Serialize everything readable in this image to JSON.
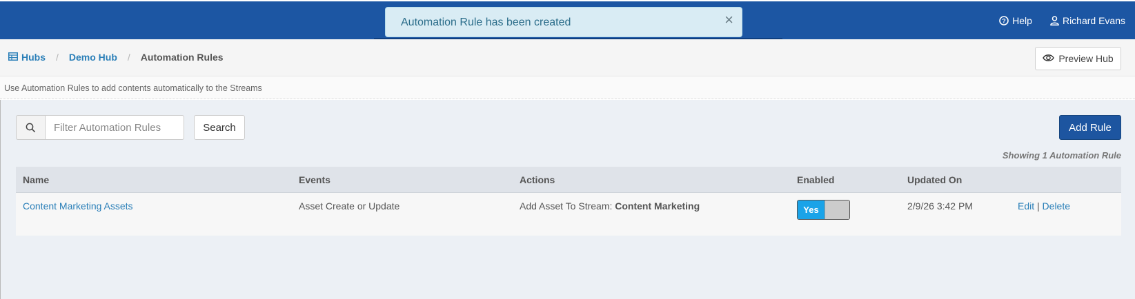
{
  "header": {
    "help_label": "Help",
    "user_name": "Richard Evans"
  },
  "toast": {
    "message": "Automation Rule has been created",
    "close_glyph": "×"
  },
  "breadcrumb": {
    "items": [
      {
        "label": "Hubs",
        "icon": "table-icon"
      },
      {
        "label": "Demo Hub"
      },
      {
        "label": "Automation Rules"
      }
    ],
    "separator": "/"
  },
  "preview_button": {
    "label": "Preview Hub",
    "icon": "eye-icon"
  },
  "description": "Use Automation Rules to add contents automatically to the Streams",
  "search": {
    "placeholder": "Filter Automation Rules",
    "value": "",
    "button_label": "Search"
  },
  "add_rule_label": "Add Rule",
  "showing_text": "Showing 1 Automation Rule",
  "table": {
    "columns": [
      "Name",
      "Events",
      "Actions",
      "Enabled",
      "Updated On"
    ],
    "rows": [
      {
        "name": "Content Marketing Assets",
        "events": "Asset Create or Update",
        "action_prefix": "Add Asset To Stream:",
        "action_target": "Content Marketing",
        "enabled_label": "Yes",
        "updated_on": "2/9/26 3:42 PM",
        "edit_label": "Edit",
        "ops_separator": "|",
        "delete_label": "Delete"
      }
    ]
  },
  "colors": {
    "header_bg": "#1c56a3",
    "link": "#2a7fb8",
    "toggle_on": "#1aa3e8",
    "primary_button": "#1d55a0"
  }
}
